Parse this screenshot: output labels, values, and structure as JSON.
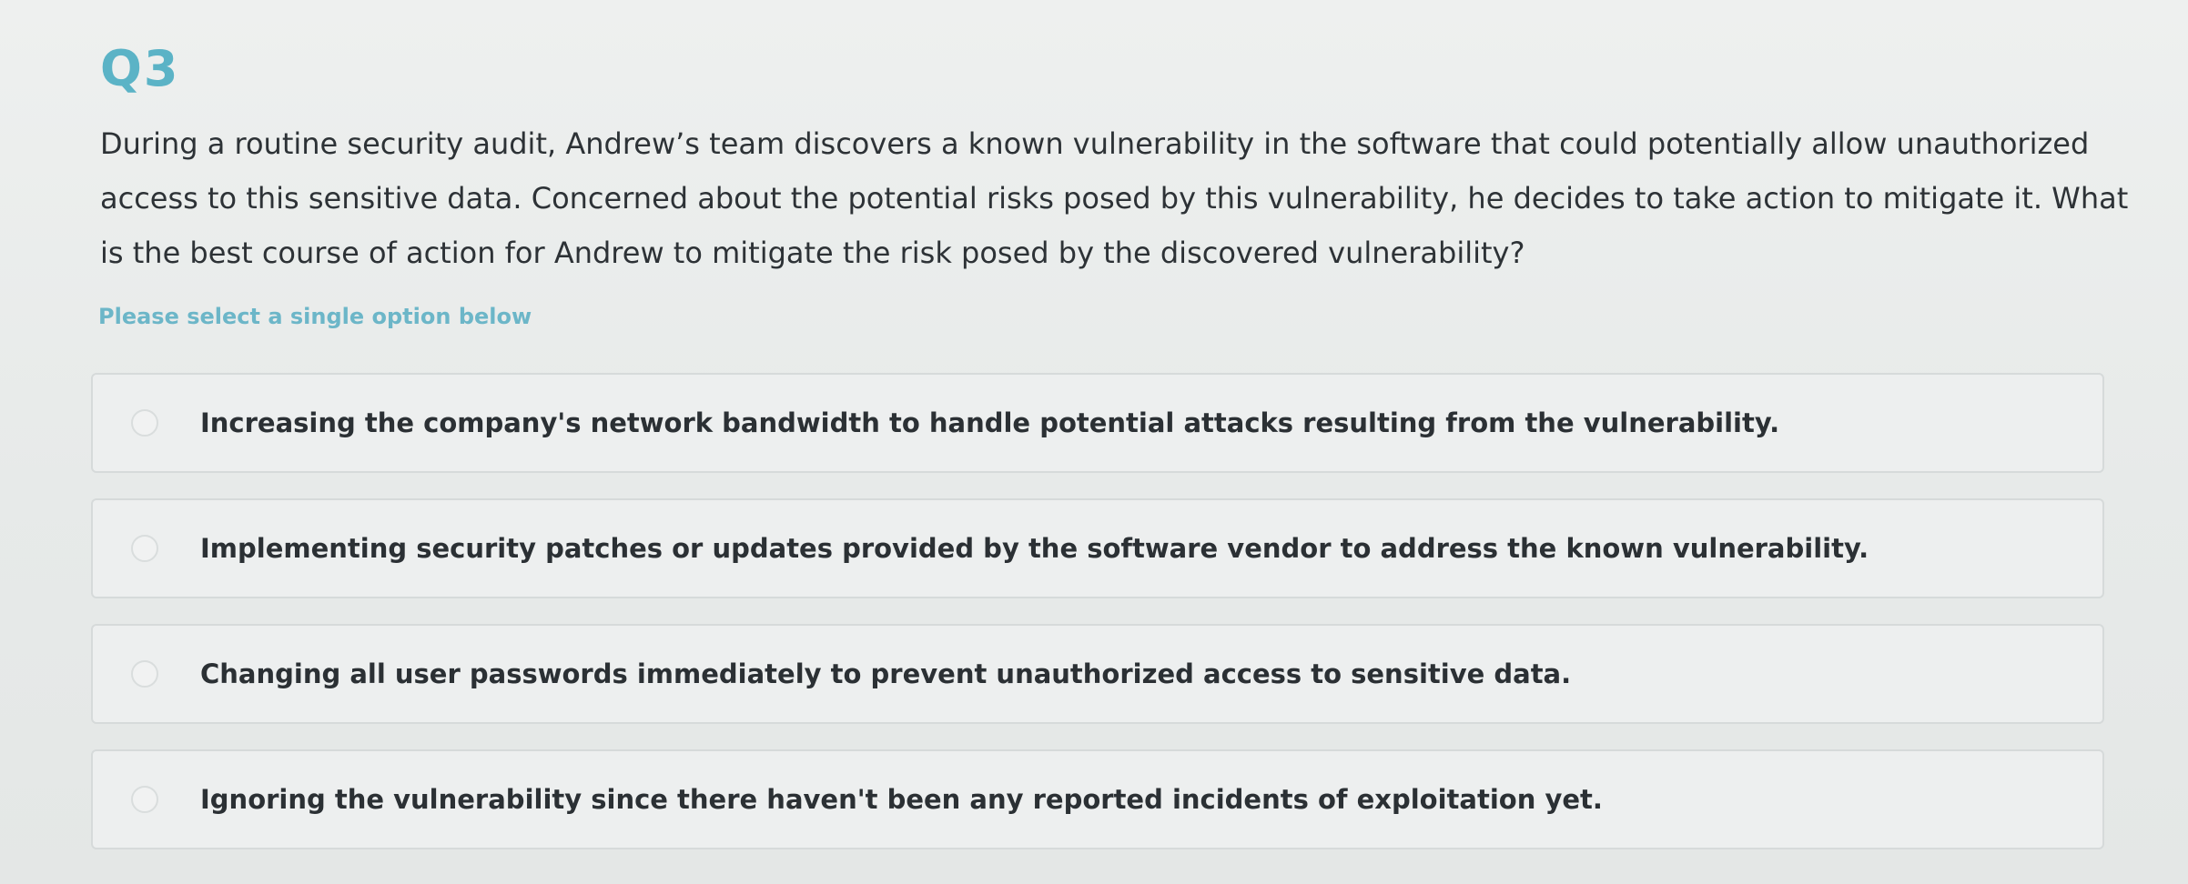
{
  "question": {
    "number": "Q3",
    "text": "During a routine security audit, Andrew’s team discovers a known vulnerability in the software that could potentially allow unauthorized access to this sensitive data. Concerned about the potential risks posed by this vulnerability, he decides to take action to mitigate it. What is the best course of action for Andrew to mitigate the risk posed by the discovered vulnerability?",
    "instruction": "Please select a single option below"
  },
  "options": [
    {
      "label": "Increasing the company's network bandwidth to handle potential attacks resulting from the vulnerability."
    },
    {
      "label": "Implementing security patches or updates provided by the software vendor to address the known vulnerability."
    },
    {
      "label": "Changing all user passwords immediately to prevent unauthorized access to sensitive data."
    },
    {
      "label": "Ignoring the vulnerability since there haven't been any reported incidents of exploitation yet."
    }
  ],
  "colors": {
    "accent": "#5bb3c6",
    "text": "#2b3034",
    "border": "#d6dada"
  }
}
